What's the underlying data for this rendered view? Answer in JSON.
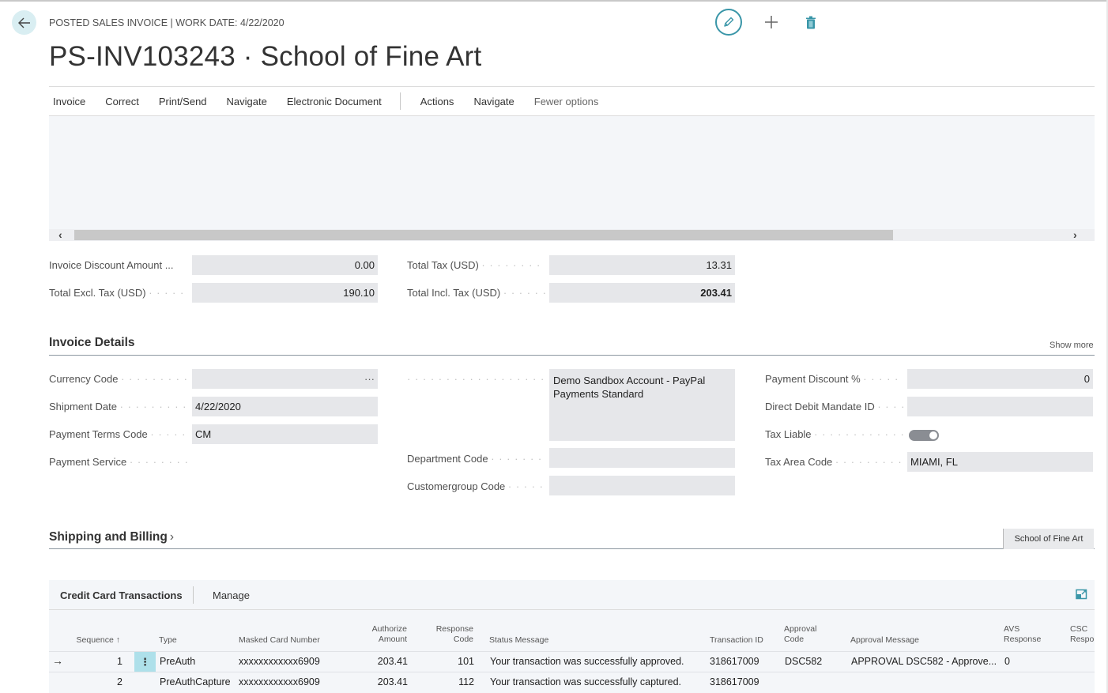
{
  "header": {
    "caption": "POSTED SALES INVOICE | WORK DATE: 4/22/2020",
    "title": "PS-INV103243 · School of Fine Art",
    "icons": [
      "back-arrow-icon",
      "edit-pencil-icon",
      "plus-icon",
      "trash-icon"
    ]
  },
  "actionbar": {
    "items": [
      "Invoice",
      "Correct",
      "Print/Send",
      "Navigate",
      "Electronic Document"
    ],
    "items2": [
      "Actions",
      "Navigate"
    ],
    "fewer": "Fewer options"
  },
  "scroll": {
    "left": "‹",
    "right": "›"
  },
  "totals": {
    "invoice_discount_label": "Invoice Discount Amount ...",
    "invoice_discount_value": "0.00",
    "total_excl_label": "Total Excl. Tax (USD)",
    "total_excl_value": "190.10",
    "total_tax_label": "Total Tax (USD)",
    "total_tax_value": "13.31",
    "total_incl_label": "Total Incl. Tax (USD)",
    "total_incl_value": "203.41"
  },
  "invoice_details": {
    "title": "Invoice Details",
    "show_more": "Show more",
    "currency_code_label": "Currency Code",
    "currency_code_value": "",
    "currency_code_assist": "···",
    "shipment_date_label": "Shipment Date",
    "shipment_date_value": "4/22/2020",
    "payment_terms_label": "Payment Terms Code",
    "payment_terms_value": "CM",
    "payment_service_label": "Payment Service",
    "payment_service_value": "Demo Sandbox Account - PayPal Payments Standard",
    "department_code_label": "Department Code",
    "department_code_value": "",
    "customergroup_code_label": "Customergroup Code",
    "customergroup_code_value": "",
    "payment_discount_label": "Payment Discount %",
    "payment_discount_value": "0",
    "direct_debit_label": "Direct Debit Mandate ID",
    "direct_debit_value": "",
    "tax_liable_label": "Tax Liable",
    "tax_liable_value": true,
    "tax_area_label": "Tax Area Code",
    "tax_area_value": "MIAMI, FL"
  },
  "shipping": {
    "title": "Shipping and Billing",
    "chevron": "›",
    "customer_tab": "School of Fine Art"
  },
  "cc": {
    "title": "Credit Card Transactions",
    "manage": "Manage",
    "columns": {
      "sequence": "Sequence ↑",
      "type": "Type",
      "masked": "Masked Card Number",
      "auth_amount_1": "Authorize",
      "auth_amount_2": "Amount",
      "resp_code_1": "Response",
      "resp_code_2": "Code",
      "status": "Status Message",
      "txn_id": "Transaction ID",
      "appr_code_1": "Approval",
      "appr_code_2": "Code",
      "appr_msg": "Approval Message",
      "avs_1": "AVS",
      "avs_2": "Response",
      "csc_1": "CSC",
      "csc_2": "Respo"
    },
    "rows": [
      {
        "sequence": "1",
        "type": "PreAuth",
        "masked": "xxxxxxxxxxxx6909",
        "amount": "203.41",
        "code": "101",
        "status": "Your transaction was successfully approved.",
        "txn_id": "318617009",
        "appr_code": "DSC582",
        "appr_msg": "APPROVAL DSC582 - Approve...",
        "avs": "0",
        "csc": ""
      },
      {
        "sequence": "2",
        "type": "PreAuthCapture",
        "masked": "xxxxxxxxxxxx6909",
        "amount": "203.41",
        "code": "112",
        "status": "Your transaction was successfully captured.",
        "txn_id": "318617009",
        "appr_code": "",
        "appr_msg": "",
        "avs": "",
        "csc": ""
      }
    ]
  },
  "colors": {
    "accent": "#3a96a8",
    "field_bg": "#e6e7ea",
    "panel_bg": "#f4f6f9",
    "selected_cell": "#aee0ea"
  }
}
